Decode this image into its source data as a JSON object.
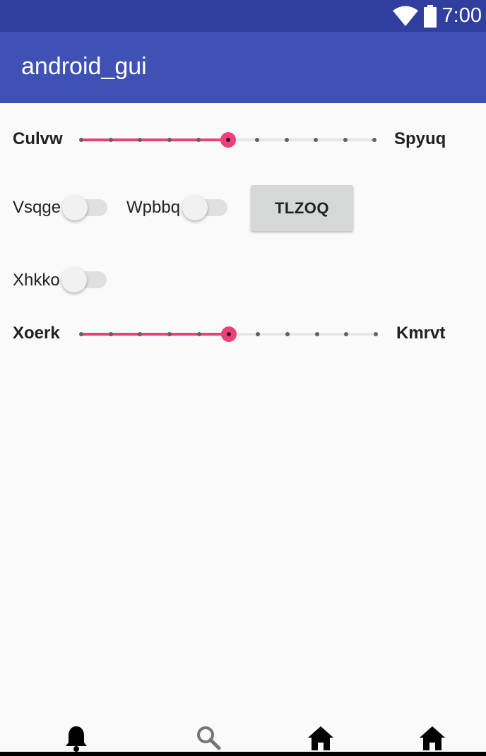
{
  "status_bar": {
    "time": "7:00",
    "icons": [
      "wifi-icon",
      "battery-icon"
    ]
  },
  "app_bar": {
    "title": "android_gui",
    "color": "#3f51b5",
    "status_color": "#303f9f"
  },
  "content": {
    "seekbar1": {
      "left_label": "Culvw",
      "right_label": "Spyuq",
      "value": 5,
      "max": 10
    },
    "switch1": {
      "label": "Vsqge",
      "checked": false
    },
    "switch2": {
      "label": "Wpbbq",
      "checked": false
    },
    "button": {
      "label": "TLZOQ"
    },
    "switch3": {
      "label": "Xhkko",
      "checked": false
    },
    "seekbar2": {
      "left_label": "Xoerk",
      "right_label": "Kmrvt",
      "value": 5,
      "max": 10
    }
  },
  "bottom_nav": {
    "items": [
      {
        "icon": "bell-icon"
      },
      {
        "icon": "search-icon"
      },
      {
        "icon": "home-icon"
      },
      {
        "icon": "home-icon"
      }
    ]
  },
  "accent_color": "#ec407a"
}
